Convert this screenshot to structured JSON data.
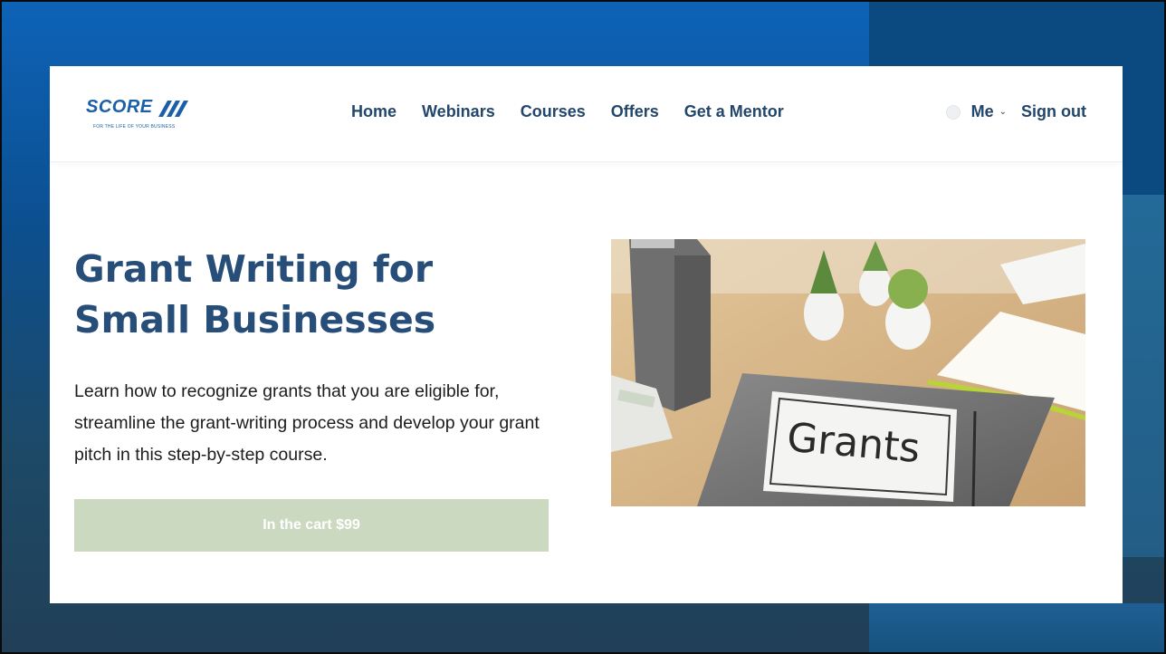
{
  "brand": {
    "name": "SCORE",
    "tagline": "FOR THE LIFE OF YOUR BUSINESS"
  },
  "nav": {
    "items": [
      {
        "label": "Home"
      },
      {
        "label": "Webinars"
      },
      {
        "label": "Courses"
      },
      {
        "label": "Offers"
      },
      {
        "label": "Get a Mentor"
      }
    ],
    "me_label": "Me",
    "me_chevron": "⌄",
    "signout_label": "Sign out"
  },
  "hero": {
    "title_line1": "Grant Writing for",
    "title_line2": "Small Businesses",
    "description": "Learn how to recognize grants that you are eligible for, streamline the grant-writing process and develop your grant pitch in this step-by-step course.",
    "cta_label": "In the cart $99",
    "image_text": "Grants"
  },
  "colors": {
    "brand_blue": "#1a5fa8",
    "nav_text": "#23466b",
    "title": "#274d79",
    "cta_bg": "#ccd9c1"
  }
}
